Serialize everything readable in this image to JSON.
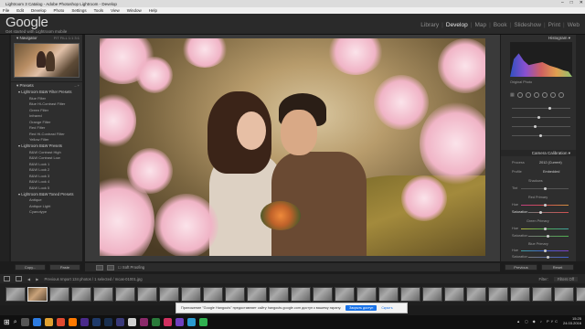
{
  "window": {
    "title": "Lightroom 3 Catalog - Adobe Photoshop Lightroom - Develop",
    "controls": [
      "–",
      "□",
      "✕"
    ]
  },
  "menu": [
    "File",
    "Edit",
    "Develop",
    "Photo",
    "Settings",
    "Tools",
    "View",
    "Window",
    "Help"
  ],
  "identity": {
    "logo": "Google",
    "tagline": "Get started with Lightroom mobile"
  },
  "modules": [
    "Library",
    "Develop",
    "Map",
    "Book",
    "Slideshow",
    "Print",
    "Web"
  ],
  "active_module": "Develop",
  "navigator": {
    "title": "Navigator",
    "zoom": "FIT  FILL  1:1  3:1"
  },
  "presets": {
    "title": "Presets",
    "folders": [
      {
        "name": "Lightroom B&W Filter Presets",
        "items": [
          "Blue Filter",
          "Blue Hi-Contrast Filter",
          "Green Filter",
          "Infrared",
          "Orange Filter",
          "Red Filter",
          "Red Hi-Contrast Filter",
          "Yellow Filter"
        ]
      },
      {
        "name": "Lightroom B&W Presets",
        "items": [
          "B&W Contrast High",
          "B&W Contrast Low",
          "B&W Look 1",
          "B&W Look 2",
          "B&W Look 3",
          "B&W Look 4",
          "B&W Look 5"
        ]
      },
      {
        "name": "Lightroom B&W Toned Presets",
        "items": [
          "Antique",
          "Antique Light",
          "Cyanotype"
        ]
      }
    ]
  },
  "left_buttons": {
    "copy": "Copy...",
    "paste": "Paste"
  },
  "histogram": {
    "title": "Histogram",
    "original": "Original Photo"
  },
  "camera_calibration": {
    "title": "Camera Calibration",
    "process_label": "Process",
    "process_value": "2012 (Current)",
    "profile_label": "Profile",
    "profile_value": "Embedded",
    "shadows": "Shadows",
    "tint": "Tint",
    "red_primary": "Red Primary",
    "hue": "Hue",
    "saturation": "Saturation",
    "green_primary": "Green Primary",
    "blue_primary": "Blue Primary"
  },
  "right_buttons": {
    "previous": "Previous",
    "reset": "Reset"
  },
  "toolbar": {
    "soft_proofing": "Soft Proofing"
  },
  "filmstrip_bar": {
    "info": "Previous Import   134 photos / 1 selected / mcas-01001.jpg",
    "filter_label": "Filter:",
    "filter_value": "Filters Off"
  },
  "notification": {
    "text": "Приложение \"Google Hangouts\" предоставляет сайту hangouts.google.com доступ к вашему экрану.",
    "share": "Закрыть доступ",
    "hide": "Скрыть"
  },
  "tray": {
    "time": "15:25",
    "date": "24.03.2016",
    "lang": "РУС"
  },
  "colors": {
    "accent": "#1a73e8",
    "panel": "#2e2e2e",
    "bg": "#1c1c1c"
  },
  "filmstrip_count": 29,
  "filmstrip_selected": 1
}
